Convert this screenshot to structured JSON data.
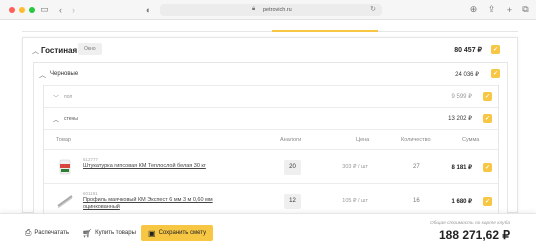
{
  "browser": {
    "url": "petrovich.ru",
    "lock_icon": "lock-icon",
    "sidebar_icon": "sidebar-icon",
    "back_icon": "chevron-left-icon",
    "forward_icon": "chevron-right-icon",
    "shield_icon": "shield-icon",
    "reload_icon": "reload-icon",
    "download_icon": "download-icon",
    "share_icon": "share-icon",
    "newtab_icon": "plus-icon",
    "tabs_icon": "tabs-icon"
  },
  "room": {
    "title": "Гостиная",
    "chip": "Окно",
    "sum": "80 457 ₽"
  },
  "group": {
    "title": "Черновые",
    "sum": "24 036 ₽"
  },
  "sections": [
    {
      "title": "пол",
      "sum": "9 599 ₽"
    },
    {
      "title": "стены",
      "sum": "13 202 ₽"
    }
  ],
  "table": {
    "headers": {
      "product": "Товар",
      "analogs": "Аналоги",
      "price": "Цена",
      "qty": "Количество",
      "sum": "Сумма"
    },
    "rows": [
      {
        "article": "612777",
        "name": "Штукатурка гипсовая КМ Теплослой белая 30 кг",
        "name2": "",
        "analogs": "20",
        "price": "303 ₽ / шт",
        "qty": "27",
        "sum": "8 181 ₽"
      },
      {
        "article": "601181",
        "name": "Профиль маячковый КМ Экспест 6 мм 3 м 0,60 мм",
        "name2": "оцинкованный",
        "analogs": "12",
        "price": "105 ₽ / шт",
        "qty": "16",
        "sum": "1 680 ₽"
      }
    ]
  },
  "footer": {
    "print_label": "Распечатать",
    "buy_label": "Купить товары",
    "save_label": "Сохранить смету",
    "total_caption": "Общая стоимость по карте клуба",
    "total_value": "188 271,62 ₽"
  },
  "colors": {
    "accent": "#f7c744"
  }
}
